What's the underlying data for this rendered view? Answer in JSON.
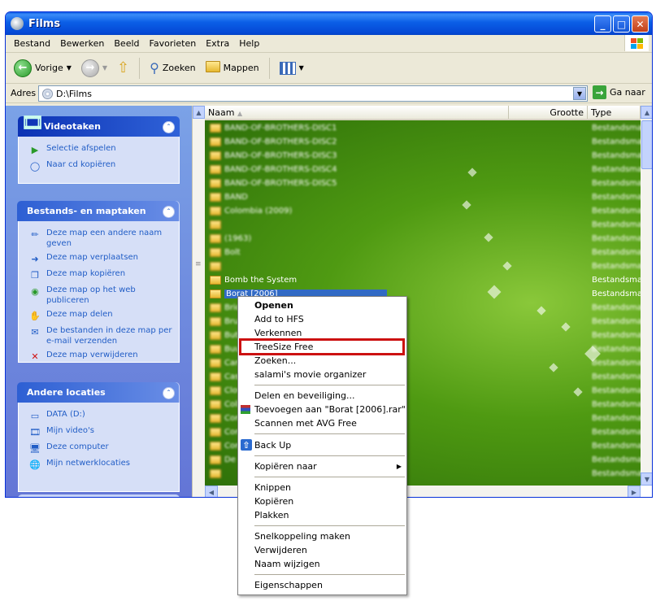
{
  "window": {
    "title": "Films",
    "buttons": [
      "_",
      "□",
      "✕"
    ]
  },
  "menubar": [
    "Bestand",
    "Bewerken",
    "Beeld",
    "Favorieten",
    "Extra",
    "Help"
  ],
  "toolbar": {
    "back": "Vorige",
    "search": "Zoeken",
    "folders": "Mappen"
  },
  "address": {
    "label": "Adres",
    "path": "D:\\Films",
    "go": "Ga naar"
  },
  "sidebar": {
    "video": {
      "title": "Videotaken",
      "items": [
        "Selectie afspelen",
        "Naar cd kopiëren"
      ]
    },
    "tasks": {
      "title": "Bestands- en maptaken",
      "items": [
        "Deze map een andere naam geven",
        "Deze map verplaatsen",
        "Deze map kopiëren",
        "Deze map op het web publiceren",
        "Deze map delen",
        "De bestanden in deze map per e-mail verzenden",
        "Deze map verwijderen"
      ]
    },
    "other": {
      "title": "Andere locaties",
      "items": [
        "DATA (D:)",
        "Mijn video's",
        "Deze computer",
        "Mijn netwerklocaties"
      ]
    }
  },
  "columns": {
    "name": "Naam",
    "size": "Grootte",
    "type": "Type"
  },
  "files": [
    {
      "name": "BAND-OF-BROTHERS-DISC1",
      "type": "Bestandsmap"
    },
    {
      "name": "BAND-OF-BROTHERS-DISC2",
      "type": "Bestandsmap"
    },
    {
      "name": "BAND-OF-BROTHERS-DISC3",
      "type": "Bestandsmap"
    },
    {
      "name": "BAND-OF-BROTHERS-DISC4",
      "type": "Bestandsmap"
    },
    {
      "name": "BAND-OF-BROTHERS-DISC5",
      "type": "Bestandsmap"
    },
    {
      "name": "BAND",
      "type": "Bestandsmap"
    },
    {
      "name": "Colombia (2009)",
      "type": "Bestandsmap"
    },
    {
      "name": "",
      "type": "Bestandsmap"
    },
    {
      "name": "(1963)",
      "type": "Bestandsmap"
    },
    {
      "name": "Bolt",
      "type": "Bestandsmap"
    },
    {
      "name": "",
      "type": "Bestandsmap"
    },
    {
      "name": "Bomb the System",
      "type": "Bestandsmap"
    },
    {
      "name": "Borat [2006]",
      "type": "Bestandsmap"
    },
    {
      "name": "Bride",
      "type": "Bestandsmap"
    },
    {
      "name": "Brun",
      "type": "Bestandsmap"
    },
    {
      "name": "Butt",
      "type": "Bestandsmap"
    },
    {
      "name": "Buun",
      "type": "Bestandsmap"
    },
    {
      "name": "Cars",
      "type": "Bestandsmap"
    },
    {
      "name": "Cast",
      "type": "Bestandsmap"
    },
    {
      "name": "Clov",
      "type": "Bestandsmap"
    },
    {
      "name": "Colla",
      "type": "Bestandsmap"
    },
    {
      "name": "Comi",
      "type": "Bestandsmap"
    },
    {
      "name": "Conj",
      "type": "Bestandsmap"
    },
    {
      "name": "Cont",
      "type": "Bestandsmap"
    },
    {
      "name": "De L",
      "type": "Bestandsmap"
    },
    {
      "name": "",
      "type": "Bestandsmap"
    }
  ],
  "context_menu": {
    "open": "Openen",
    "hfs": "Add to HFS",
    "explore": "Verkennen",
    "treesize": "TreeSize Free",
    "search": "Zoeken...",
    "organizer": "salami's movie organizer",
    "share": "Delen en beveiliging...",
    "rar": "Toevoegen aan \"Borat [2006].rar\"",
    "avg": "Scannen met AVG Free",
    "backup": "Back Up",
    "copyto": "Kopiëren naar",
    "cut": "Knippen",
    "copy": "Kopiëren",
    "paste": "Plakken",
    "shortcut": "Snelkoppeling maken",
    "delete": "Verwijderen",
    "rename": "Naam wijzigen",
    "properties": "Eigenschappen"
  },
  "colors": {
    "title_bar": "#0a5ee6",
    "highlight": "#cc1111",
    "sidebar": "#7ba2e7"
  }
}
